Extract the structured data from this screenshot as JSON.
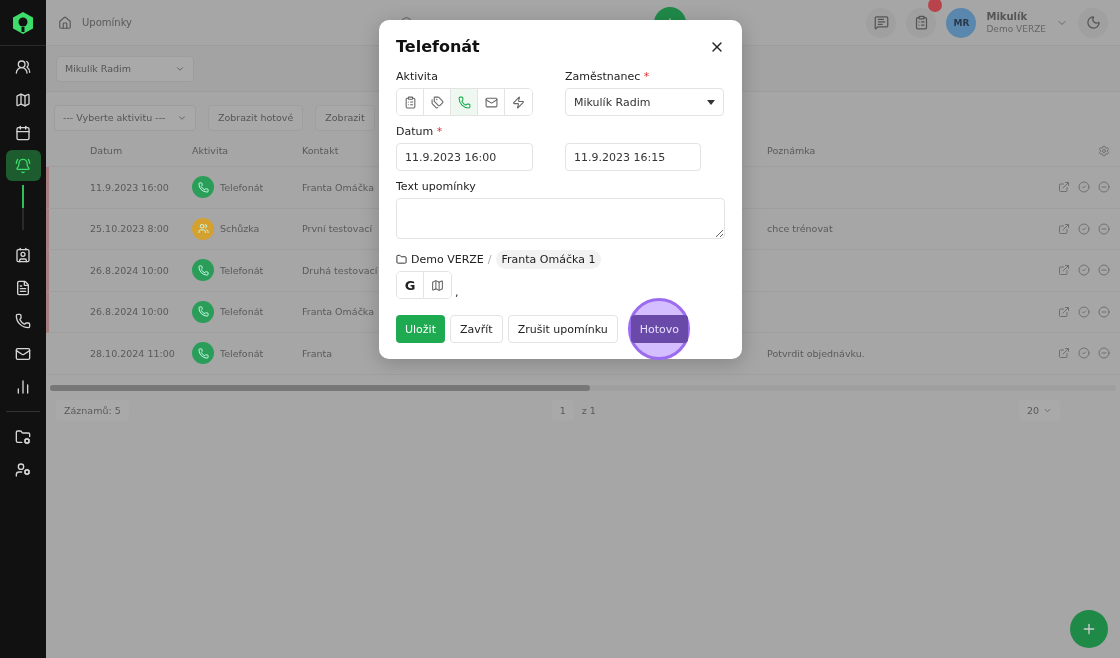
{
  "sidebar": {
    "items": [
      {
        "kind": "contacts",
        "selected": false
      },
      {
        "kind": "map",
        "selected": false
      },
      {
        "kind": "calendar",
        "selected": false
      },
      {
        "kind": "reminders",
        "selected": true
      },
      {
        "kind": "contact-card",
        "selected": false
      },
      {
        "kind": "document",
        "selected": false
      },
      {
        "kind": "phone",
        "selected": false
      },
      {
        "kind": "mail",
        "selected": false
      },
      {
        "kind": "chart",
        "selected": false
      }
    ],
    "bottom_items": [
      {
        "kind": "folder-settings",
        "selected": false
      },
      {
        "kind": "user-settings",
        "selected": false
      }
    ]
  },
  "topbar": {
    "breadcrumb": "Upomínky",
    "user": {
      "initials": "MR",
      "name": "Mikulík",
      "org": "Demo VERZE"
    }
  },
  "filters": {
    "employee": "Mikulík Radim",
    "activity": "--- Vyberte aktivitu ---",
    "buttons": [
      "Zobrazit hotové",
      "Zobrazit"
    ]
  },
  "table": {
    "columns": [
      "Datum",
      "Aktivita",
      "Kontakt",
      "Poznámka"
    ],
    "rows": [
      {
        "date": "11.9.2023 16:00",
        "activity": "Telefonát",
        "kind": "call",
        "color": "#2a9d58",
        "contact": "Franta Omáčka",
        "note": "",
        "overdue": true
      },
      {
        "date": "25.10.2023 8:00",
        "activity": "Schůzka",
        "kind": "meeting",
        "color": "#d4a030",
        "contact": "První testovací",
        "note": "chce trénovat",
        "overdue": true
      },
      {
        "date": "26.8.2024 10:00",
        "activity": "Telefonát",
        "kind": "call",
        "color": "#2a9d58",
        "contact": "Druhá testovací",
        "note": "",
        "overdue": true
      },
      {
        "date": "26.8.2024 10:00",
        "activity": "Telefonát",
        "kind": "call",
        "color": "#2a9d58",
        "contact": "Franta Omáčka",
        "note": "",
        "overdue": true
      },
      {
        "date": "28.10.2024 11:00",
        "activity": "Telefonát",
        "kind": "call",
        "color": "#2a9d58",
        "contact": "Franta",
        "note": "Potvrdit objednávku.",
        "overdue": false
      }
    ]
  },
  "footer": {
    "count": "Záznamů: 5",
    "page": "1",
    "of": "z 1",
    "page_size": "20"
  },
  "dialog": {
    "title": "Telefonát",
    "required_mark": "*",
    "activity_label": {
      "text": "Aktivita",
      "required": false
    },
    "activities": [
      {
        "kind": "note",
        "selected": false
      },
      {
        "kind": "tag",
        "selected": false
      },
      {
        "kind": "call",
        "selected": true
      },
      {
        "kind": "mail",
        "selected": false
      },
      {
        "kind": "event",
        "selected": false
      }
    ],
    "employee_label": {
      "text": "Zaměstnanec",
      "required": true
    },
    "employee": "Mikulík Radim",
    "date_label": {
      "text": "Datum",
      "required": true
    },
    "date_from": "11.9.2023 16:00",
    "date_to": "11.9.2023 16:15",
    "text_label": {
      "text": "Text upomínky",
      "required": false
    },
    "path": {
      "folder": "Demo VERZE",
      "separator": "/",
      "contact": "Franta Omáčka 1"
    },
    "links": [
      {
        "kind": "google",
        "label": "G"
      },
      {
        "kind": "map"
      }
    ],
    "links_suffix": ",",
    "buttons": [
      {
        "label": "Uložit",
        "kind": "primary",
        "highlighted": false
      },
      {
        "label": "Zavřít",
        "kind": "default",
        "highlighted": false
      },
      {
        "label": "Zrušit upomínku",
        "kind": "default",
        "highlighted": false
      },
      {
        "label": "Hotovo",
        "kind": "done",
        "highlighted": true
      }
    ]
  }
}
